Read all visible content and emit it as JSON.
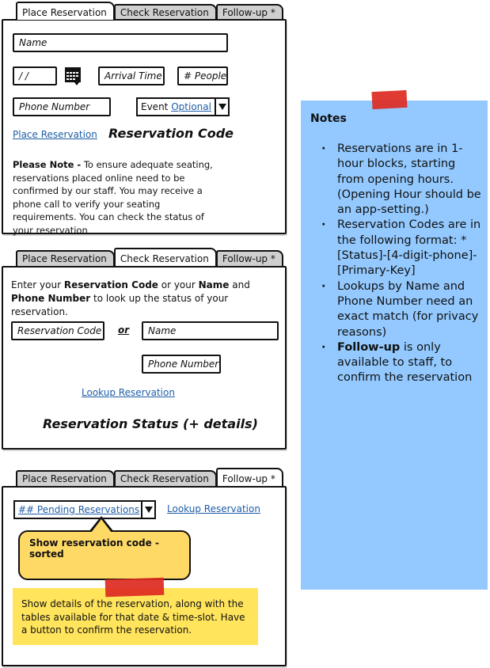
{
  "panel1": {
    "tabs": [
      "Place Reservation",
      "Check Reservation",
      "Follow-up *"
    ],
    "active_tab": 0,
    "name_placeholder": "Name",
    "date_placeholder": "/ /",
    "arrival_placeholder": "Arrival Time",
    "people_placeholder": "# People",
    "phone_placeholder": "Phone Number",
    "event_label": "Event",
    "event_value": "Optional",
    "place_link": "Place Reservation",
    "code_heading": "Reservation Code",
    "note_bold": "Please Note -",
    "note_text": " To ensure adequate seating, reservations placed online need to be confirmed by our staff. You may receive a phone call to verify your seating requirements. You can check the status of your reservation"
  },
  "panel2": {
    "tabs": [
      "Place Reservation",
      "Check Reservation",
      "Follow-up *"
    ],
    "active_tab": 1,
    "intro": {
      "t1": "Enter your ",
      "b1": "Reservation Code",
      "t2": " or your ",
      "b2": "Name",
      "t3": " and ",
      "b3": "Phone Number",
      "t4": " to look up the status of your reservation."
    },
    "code_placeholder": "Reservation Code",
    "or_label": "or",
    "name_placeholder": "Name",
    "phone_placeholder": "Phone Number",
    "lookup_link": "Lookup Reservation",
    "status_heading": "Reservation Status (+ details)"
  },
  "panel3": {
    "tabs": [
      "Place Reservation",
      "Check Reservation",
      "Follow-up *"
    ],
    "active_tab": 2,
    "pending_select": "## Pending Reservations",
    "lookup_link": "Lookup Reservation",
    "callout_text": "Show reservation code - sorted",
    "sticky_text": "Show details of the reservation, along with the tables available for that date & time-slot. Have a button to confirm the reservation."
  },
  "notes": {
    "title": "Notes",
    "items": [
      {
        "bold": "",
        "text": "Reservations are in 1-hour blocks, starting from opening hours. (Opening Hour should be an app-setting.)"
      },
      {
        "bold": "",
        "text": "Reservation Codes are in the following format: * [Status]-[4-digit-phone]-[Primary-Key]"
      },
      {
        "bold": "",
        "text": "Lookups by Name and Phone Number need an exact match (for privacy reasons)"
      },
      {
        "bold": "Follow-up",
        "text": " is only available to staff, to confirm the reservation"
      }
    ]
  },
  "colors": {
    "link": "#1f5ea8",
    "tab_inactive": "#cfcfcf",
    "sticky_blue": "#93c9ff",
    "sticky_yellow": "#ffe45c",
    "callout": "#ffd966",
    "tape": "#dd2a22"
  }
}
